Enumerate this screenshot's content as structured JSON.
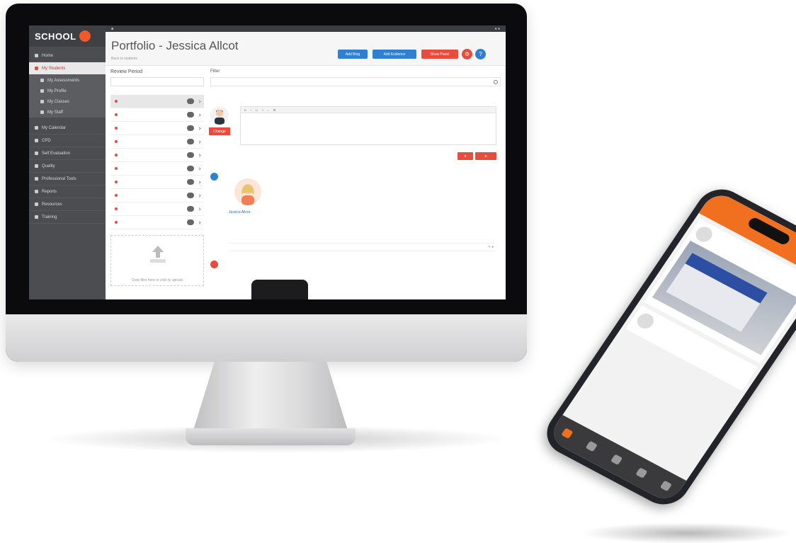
{
  "app": {
    "logo": "SCHOOL"
  },
  "sidebar": {
    "items": [
      {
        "label": "Home"
      },
      {
        "label": "My Students"
      },
      {
        "label": "My Assessments"
      },
      {
        "label": "My Profile"
      },
      {
        "label": "My Classes"
      },
      {
        "label": "My Staff"
      },
      {
        "label": "My Calendar"
      },
      {
        "label": "CPD"
      },
      {
        "label": "Self Evaluation"
      },
      {
        "label": "Quality"
      },
      {
        "label": "Professional Tools"
      },
      {
        "label": "Reports"
      },
      {
        "label": "Resources"
      },
      {
        "label": "Training"
      }
    ]
  },
  "header": {
    "page_title": "Portfolio - Jessica Allcot",
    "subtitle": "Back to students",
    "buttons": [
      "Add Blog",
      "Add Evidence",
      "Show Panel"
    ],
    "circle_help": "?"
  },
  "left_panel": {
    "review_label": "Review Period",
    "review_value": "",
    "categories": [
      "",
      "",
      "",
      "",
      "",
      "",
      "",
      "",
      "",
      "",
      ""
    ],
    "upload_text": "Drop files here or click to upload"
  },
  "feed": {
    "filter_label": "Filter",
    "change_button": "Change",
    "post_name": "Jessica Allcot",
    "task": "",
    "tags": "",
    "comment": "",
    "editor_placeholder": ""
  },
  "phone": {
    "time": "",
    "title": "",
    "post_name": "",
    "likes": "",
    "text": ""
  },
  "colors": {
    "accent": "#e74c3c",
    "primary": "#2f80d0",
    "brand": "#f07020",
    "sidebar": "#4b4d50"
  },
  "icons": [
    "search-icon",
    "help-icon",
    "upload-icon",
    "user-icon",
    "comment-icon"
  ]
}
